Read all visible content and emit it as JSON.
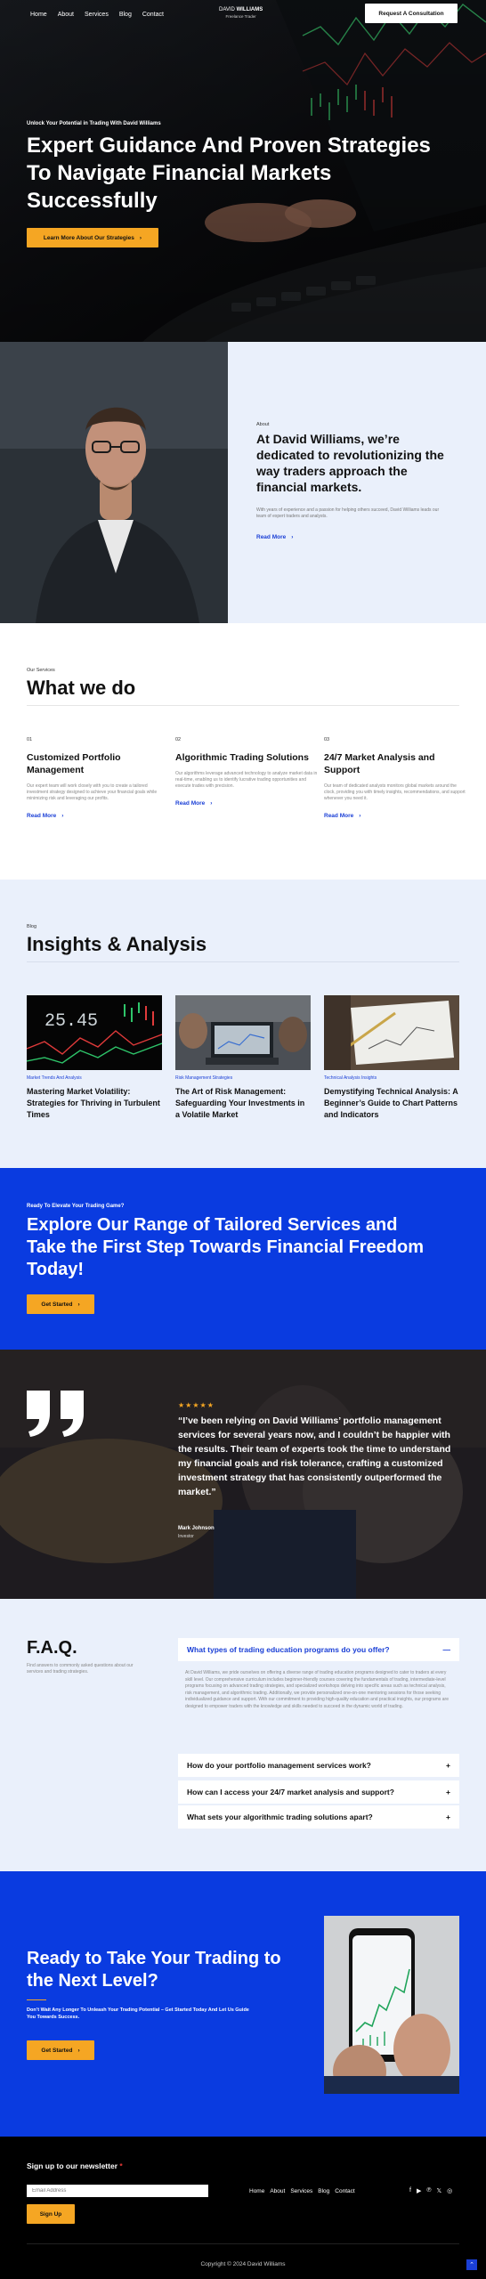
{
  "nav": {
    "links": [
      "Home",
      "About",
      "Services",
      "Blog",
      "Contact"
    ],
    "logo_first": "DAVID",
    "logo_last": "WILLIAMS",
    "logo_sub": "Freelance Trader",
    "cta": "Request A Consultation"
  },
  "hero": {
    "eyebrow": "Unlock Your Potential in Trading With David Williams",
    "title": "Expert Guidance And Proven Strategies To Navigate Financial Markets Successfully",
    "button": "Learn More About Our Strategies"
  },
  "about": {
    "label": "About",
    "title": "At David Williams, we’re dedicated to revolutionizing the way traders approach the financial markets.",
    "text": "With years of experience and a passion for helping others succeed, David Williams leads our team of expert traders and analysts.",
    "link": "Read More"
  },
  "services": {
    "label": "Our Services",
    "title": "What we do",
    "items": [
      {
        "num": "01",
        "title": "Customized Portfolio Management",
        "text": "Our expert team will work closely with you to create a tailored investment strategy designed to achieve your financial goals while minimizing risk and leveraging our profits.",
        "link": "Read More"
      },
      {
        "num": "02",
        "title": "Algorithmic Trading Solutions",
        "text": "Our algorithms leverage advanced technology to analyze market data in real-time, enabling us to identify lucrative trading opportunities and execute trades with precision.",
        "link": "Read More"
      },
      {
        "num": "03",
        "title": "24/7 Market Analysis and Support",
        "text": "Our team of dedicated analysts monitors global markets around the clock, providing you with timely insights, recommendations, and support whenever you need it.",
        "link": "Read More"
      }
    ]
  },
  "blog": {
    "label": "Blog",
    "title": "Insights & Analysis",
    "ticker": "25.45",
    "posts": [
      {
        "category": "Market Trends And Analysis",
        "title": "Mastering Market Volatility: Strategies for Thriving in Turbulent Times"
      },
      {
        "category": "Risk Management Strategies",
        "title": "The Art of Risk Management: Safeguarding Your Investments in a Volatile Market"
      },
      {
        "category": "Technical Analysis Insights",
        "title": "Demystifying Technical Analysis: A Beginner’s Guide to Chart Patterns and Indicators"
      }
    ]
  },
  "cta_blue": {
    "eyebrow": "Ready To Elevate Your Trading Game?",
    "title": "Explore Our Range of Tailored Services and Take the First Step Towards Financial Freedom Today!",
    "button": "Get Started"
  },
  "testimonial": {
    "stars": "★★★★★",
    "quote": "“I’ve been relying on David Williams’ portfolio management services for several years now, and I couldn’t be happier with the results. Their team of experts took the time to understand my financial goals and risk tolerance, crafting a customized investment strategy that has consistently outperformed the market.”",
    "author": "Mark Johnson",
    "role": "Investor"
  },
  "faq": {
    "title": "F.A.Q.",
    "intro": "Find answers to commonly asked questions about our services and trading strategies.",
    "open_question": "What types of trading education programs do you offer?",
    "answer": "At David Williams, we pride ourselves on offering a diverse range of trading education programs designed to cater to traders at every skill level. Our comprehensive curriculum includes beginner-friendly courses covering the fundamentals of trading, intermediate-level programs focusing on advanced trading strategies, and specialized workshops delving into specific areas such as technical analysis, risk management, and algorithmic trading. Additionally, we provide personalized one-on-one mentoring sessions for those seeking individualized guidance and support. With our commitment to providing high-quality education and practical insights, our programs are designed to empower traders with the knowledge and skills needed to succeed in the dynamic world of trading.",
    "questions": [
      "How do your portfolio management services work?",
      "How can I access your 24/7 market analysis and support?",
      "What sets your algorithmic trading solutions apart?"
    ]
  },
  "cta2": {
    "title": "Ready to Take Your Trading to the Next Level?",
    "text": "Don’t Wait Any Longer To Unleash Your Trading Potential – Get Started Today And Let Us Guide You Towards Success.",
    "button": "Get Started"
  },
  "footer": {
    "newsletter": "Sign up to our newsletter",
    "required": "*",
    "email_placeholder": "Email Address",
    "signup": "Sign Up",
    "links": [
      "Home",
      "About",
      "Services",
      "Blog",
      "Contact"
    ],
    "social": [
      "facebook-icon",
      "youtube-icon",
      "pinterest-icon",
      "twitter-icon",
      "instagram-icon"
    ],
    "copyright": "Copyright © 2024 David Williams"
  },
  "colors": {
    "accent_blue": "#0a3be0",
    "link_blue": "#1a3fd6",
    "gold": "#f5a623",
    "light_bg": "#eaf0fb"
  }
}
